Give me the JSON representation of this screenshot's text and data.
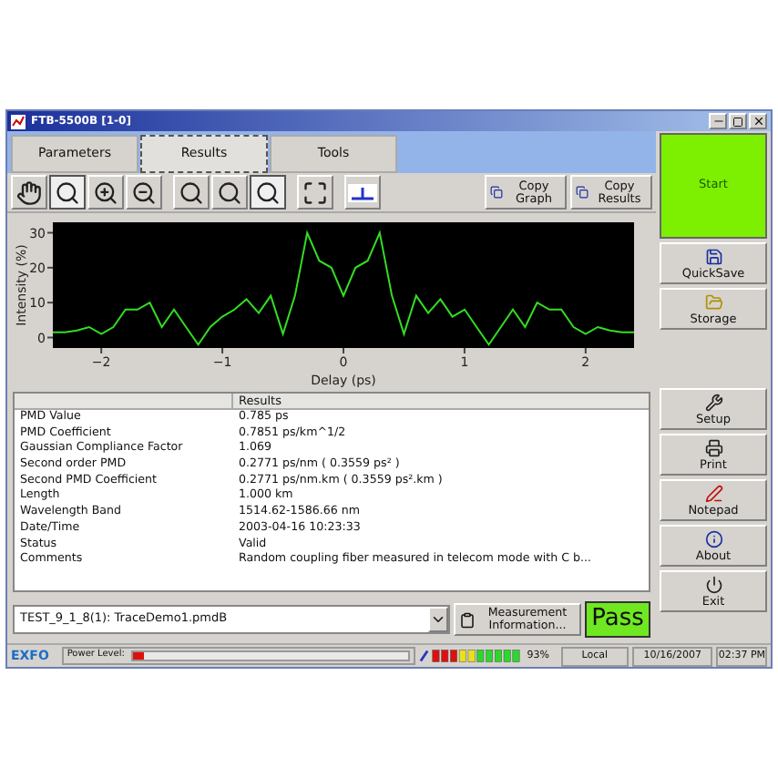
{
  "window": {
    "title": "FTB-5500B [1-0]"
  },
  "tabs": [
    {
      "label": "Parameters",
      "selected": false
    },
    {
      "label": "Results",
      "selected": true
    },
    {
      "label": "Tools",
      "selected": false
    }
  ],
  "toolbar": [
    {
      "kind": "hand",
      "selected": false
    },
    {
      "kind": "zoom-area",
      "selected": true
    },
    {
      "kind": "zoom-in",
      "selected": false
    },
    {
      "kind": "zoom-out",
      "selected": false
    },
    {
      "kind": "zoom-horizontal",
      "selected": false
    },
    {
      "kind": "zoom-vertical",
      "selected": false
    },
    {
      "kind": "zoom-both",
      "selected": true
    },
    {
      "kind": "fit",
      "selected": false
    },
    {
      "kind": "marker",
      "selected": false
    }
  ],
  "copy_buttons": [
    "Copy Graph",
    "Copy Results"
  ],
  "chart_data": {
    "type": "line",
    "xlabel": "Delay (ps)",
    "ylabel": "Intensity (%)",
    "xlim": [
      -2.4,
      2.4
    ],
    "ylim": [
      -3,
      33
    ],
    "xticks": [
      -2,
      -1,
      0,
      1,
      2
    ],
    "yticks": [
      0,
      10,
      20,
      30
    ],
    "x": [
      -2.4,
      -2.3,
      -2.2,
      -2.1,
      -2.0,
      -1.9,
      -1.8,
      -1.7,
      -1.6,
      -1.5,
      -1.4,
      -1.3,
      -1.2,
      -1.1,
      -1.0,
      -0.9,
      -0.8,
      -0.7,
      -0.6,
      -0.5,
      -0.4,
      -0.3,
      -0.2,
      -0.1,
      0,
      0.1,
      0.2,
      0.3,
      0.4,
      0.5,
      0.6,
      0.7,
      0.8,
      0.9,
      1.0,
      1.1,
      1.2,
      1.3,
      1.4,
      1.5,
      1.6,
      1.7,
      1.8,
      1.9,
      2.0,
      2.1,
      2.2,
      2.3,
      2.4
    ],
    "series": [
      {
        "color": "#33dd22",
        "values": [
          1.5,
          1.5,
          2,
          3,
          1,
          3,
          8,
          8,
          10,
          3,
          8,
          3,
          -2,
          3,
          6,
          8,
          11,
          7,
          12,
          1,
          12,
          30,
          22,
          20,
          12,
          20,
          22,
          30,
          12,
          1,
          12,
          7,
          11,
          6,
          8,
          3,
          -2,
          3,
          8,
          3,
          10,
          8,
          8,
          3,
          1,
          3,
          2,
          1.5,
          1.5
        ]
      }
    ]
  },
  "results_table": {
    "columns": [
      "",
      "Results"
    ],
    "rows": [
      [
        "PMD Value",
        "0.785 ps"
      ],
      [
        "PMD Coefficient",
        "0.7851 ps/km^1/2"
      ],
      [
        "Gaussian Compliance Factor",
        "1.069"
      ],
      [
        "Second order PMD",
        "0.2771 ps/nm (  0.3559 ps² )"
      ],
      [
        "Second PMD Coefficient",
        "0.2771 ps/nm.km (  0.3559 ps².km )"
      ],
      [
        "Length",
        "1.000 km"
      ],
      [
        "Wavelength Band",
        "1514.62-1586.66 nm"
      ],
      [
        "Date/Time",
        "2003-04-16 10:23:33"
      ],
      [
        "Status",
        "Valid"
      ],
      [
        "Comments",
        "Random coupling fiber measured in telecom mode with C b..."
      ]
    ]
  },
  "file_select": {
    "value": "TEST_9_1_8(1): TraceDemo1.pmdB"
  },
  "measurement_button": "Measurement Information...",
  "verdict": "Pass",
  "side_buttons": [
    {
      "kind": "start",
      "label": "Start"
    },
    {
      "kind": "save",
      "label": "QuickSave"
    },
    {
      "kind": "storage",
      "label": "Storage"
    },
    {
      "kind": "setup",
      "label": "Setup"
    },
    {
      "kind": "print",
      "label": "Print"
    },
    {
      "kind": "notepad",
      "label": "Notepad"
    },
    {
      "kind": "about",
      "label": "About"
    },
    {
      "kind": "exit",
      "label": "Exit"
    }
  ],
  "status_bar": {
    "logo": "EXFO",
    "power_label": "Power Level:",
    "power": {
      "level": 0.04
    },
    "battery": "93%",
    "mode": "Local",
    "date": "10/16/2007",
    "time": "02:37 PM"
  }
}
